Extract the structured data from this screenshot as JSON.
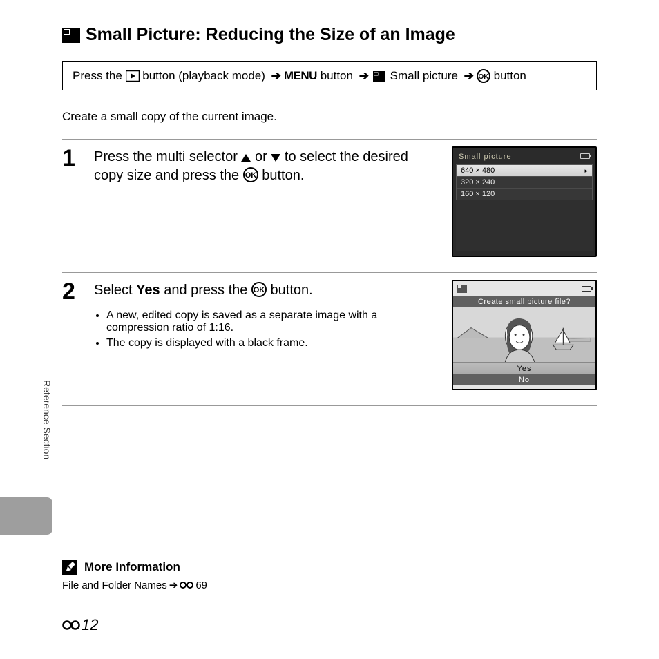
{
  "heading": "Small Picture: Reducing the Size of an Image",
  "nav": {
    "press_the": "Press the ",
    "button_playback": " button (playback mode) ",
    "menu": "MENU",
    "button": " button ",
    "small_picture": " Small picture ",
    "button2": " button"
  },
  "intro": "Create a small copy of the current image.",
  "step1": {
    "num": "1",
    "text_a": "Press the multi selector ",
    "text_b": " or ",
    "text_c": " to select the desired copy size and press the ",
    "text_d": " button.",
    "screen_title": "Small picture",
    "sizes": [
      "640 × 480",
      "320 × 240",
      "160 × 120"
    ]
  },
  "step2": {
    "num": "2",
    "text_a": "Select ",
    "text_b": "Yes",
    "text_c": " and press the ",
    "text_d": " button.",
    "bullet1": "A new, edited copy is saved as a separate image with a compression ratio of 1:16.",
    "bullet2": "The copy is displayed with a black frame.",
    "screen_q": "Create small picture file?",
    "yes": "Yes",
    "no": "No"
  },
  "side_label": "Reference Section",
  "more_info": {
    "title": "More Information",
    "text": "File and Folder Names ",
    "arrow": "➔",
    "page": "69"
  },
  "page_number": "12"
}
